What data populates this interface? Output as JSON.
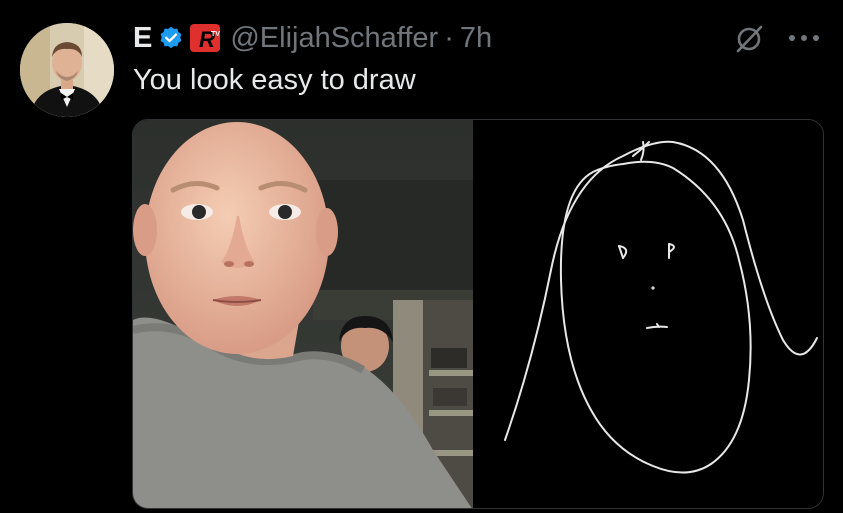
{
  "author": {
    "display_name": "E",
    "handle": "@ElijahSchaffer",
    "separator": "·",
    "time": "7h",
    "avatar_icon": "avatar-portrait",
    "verified_icon": "verified-badge-icon",
    "badge_icon": "brand-badge-icon"
  },
  "tweet": {
    "text": "You look easy to draw"
  },
  "actions": {
    "grok_icon": "grok-icon",
    "more_icon": "more-icon"
  },
  "media": {
    "left_image": "selfie-photo",
    "right_image": "line-drawing"
  },
  "colors": {
    "background": "#000000",
    "text": "#e7e9ea",
    "secondary": "#71767b",
    "verified": "#1d9bf0",
    "badge": "#e0302d"
  }
}
